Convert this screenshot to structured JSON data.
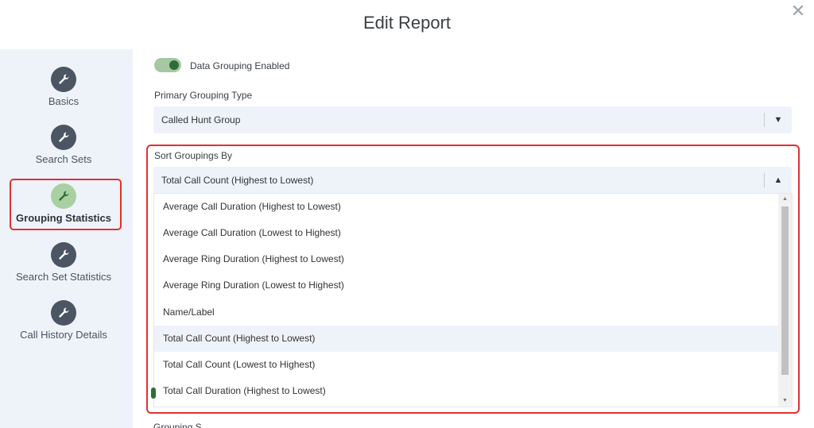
{
  "header": {
    "title": "Edit Report"
  },
  "sidebar": {
    "items": [
      {
        "label": "Basics",
        "icon": "wrench-icon"
      },
      {
        "label": "Search Sets",
        "icon": "wrench-icon"
      },
      {
        "label": "Grouping Statistics",
        "icon": "wrench-icon",
        "active": true
      },
      {
        "label": "Search Set Statistics",
        "icon": "wrench-icon"
      },
      {
        "label": "Call History Details",
        "icon": "wrench-icon"
      }
    ]
  },
  "main": {
    "toggle": {
      "label": "Data Grouping Enabled",
      "on": true
    },
    "primary_grouping": {
      "label": "Primary Grouping Type",
      "value": "Called Hunt Group"
    },
    "sort_groupings": {
      "label": "Sort Groupings By",
      "value": "Total Call Count (Highest to Lowest)",
      "options": [
        "Average Call Duration (Highest to Lowest)",
        "Average Call Duration (Lowest to Highest)",
        "Average Ring Duration (Highest to Lowest)",
        "Average Ring Duration (Lowest to Highest)",
        "Name/Label",
        "Total Call Count (Highest to Lowest)",
        "Total Call Count (Lowest to Highest)",
        "Total Call Duration (Highest to Lowest)"
      ],
      "highlighted": "Total Call Count (Highest to Lowest)"
    },
    "peek_label": "Grouping S"
  },
  "colors": {
    "accent_green": "#2f6d37",
    "highlight_red": "#e03131",
    "sidebar_bg": "#eef3fa"
  }
}
